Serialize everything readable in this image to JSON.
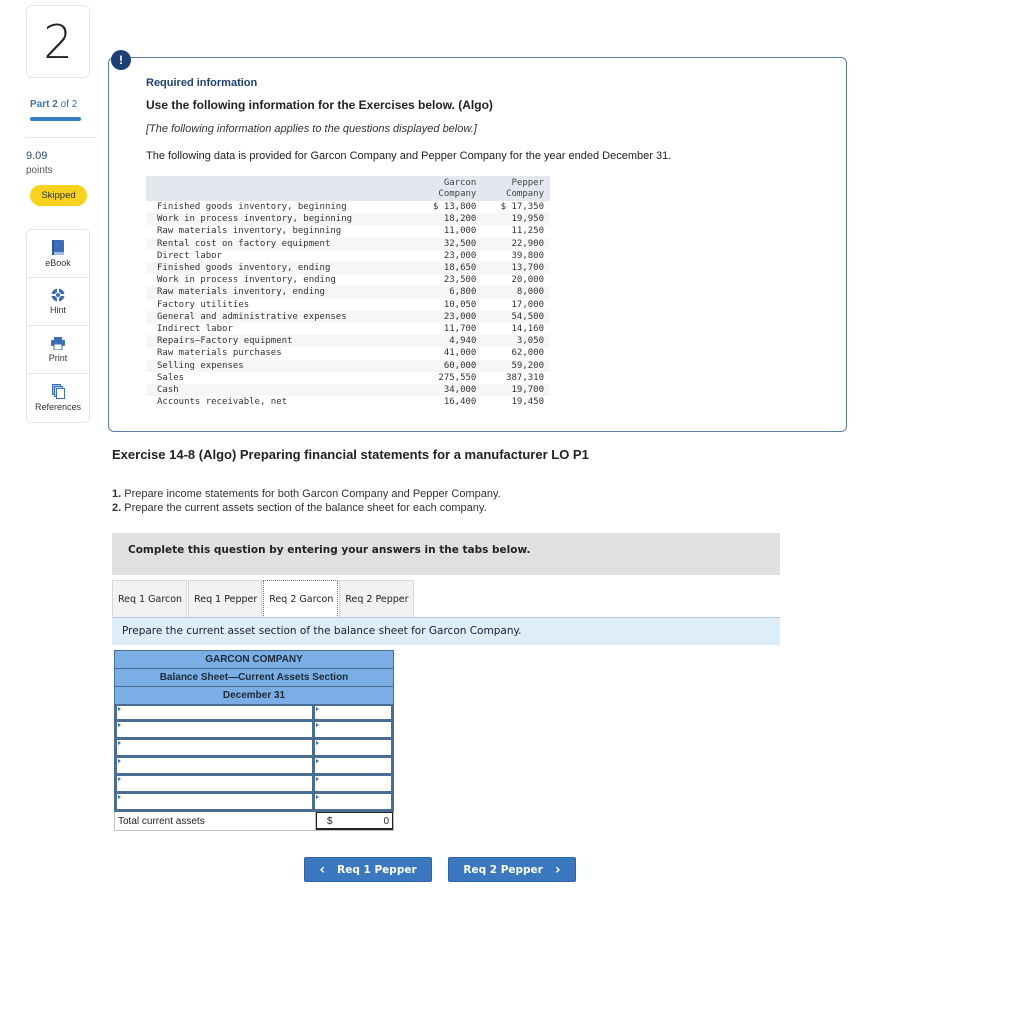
{
  "question": {
    "number": "2",
    "part_label": "Part",
    "part_current": "2",
    "part_of": "of 2",
    "part_progress": 1.0,
    "points_value": "9.09",
    "points_label": "points",
    "status": "Skipped"
  },
  "tools": [
    {
      "label": "eBook",
      "icon": "book-icon"
    },
    {
      "label": "Hint",
      "icon": "lifebuoy-icon"
    },
    {
      "label": "Print",
      "icon": "printer-icon"
    },
    {
      "label": "References",
      "icon": "documents-icon"
    }
  ],
  "info_card": {
    "badge": "!",
    "heading": "Required information",
    "title": "Use the following information for the Exercises below. (Algo)",
    "applies_note": "[The following information applies to the questions displayed below.]",
    "intro": "The following data is provided for Garcon Company and Pepper Company for the year ended December 31.",
    "table": {
      "headers": [
        "",
        "Garcon\nCompany",
        "Pepper\nCompany"
      ],
      "header_lines": [
        [
          "Garcon",
          "Company"
        ],
        [
          "Pepper",
          "Company"
        ]
      ],
      "rows": [
        {
          "label": "Finished goods inventory, beginning",
          "garcon": "$ 13,800",
          "pepper": "$ 17,350"
        },
        {
          "label": "Work in process inventory, beginning",
          "garcon": "18,200",
          "pepper": "19,950"
        },
        {
          "label": "Raw materials inventory, beginning",
          "garcon": "11,000",
          "pepper": "11,250"
        },
        {
          "label": "Rental cost on factory equipment",
          "garcon": "32,500",
          "pepper": "22,900"
        },
        {
          "label": "Direct labor",
          "garcon": "23,000",
          "pepper": "39,800"
        },
        {
          "label": "Finished goods inventory, ending",
          "garcon": "18,650",
          "pepper": "13,700"
        },
        {
          "label": "Work in process inventory, ending",
          "garcon": "23,500",
          "pepper": "20,000"
        },
        {
          "label": "Raw materials inventory, ending",
          "garcon": "6,800",
          "pepper": "8,000"
        },
        {
          "label": "Factory utilities",
          "garcon": "10,050",
          "pepper": "17,000"
        },
        {
          "label": "General and administrative expenses",
          "garcon": "23,000",
          "pepper": "54,500"
        },
        {
          "label": "Indirect labor",
          "garcon": "11,700",
          "pepper": "14,160"
        },
        {
          "label": "Repairs—Factory equipment",
          "garcon": "4,940",
          "pepper": "3,050"
        },
        {
          "label": "Raw materials purchases",
          "garcon": "41,000",
          "pepper": "62,000"
        },
        {
          "label": "Selling expenses",
          "garcon": "60,000",
          "pepper": "59,200"
        },
        {
          "label": "Sales",
          "garcon": "275,550",
          "pepper": "387,310"
        },
        {
          "label": "Cash",
          "garcon": "34,000",
          "pepper": "19,700"
        },
        {
          "label": "Accounts receivable, net",
          "garcon": "16,400",
          "pepper": "19,450"
        }
      ]
    }
  },
  "exercise": {
    "title": "Exercise 14-8 (Algo) Preparing financial statements for a manufacturer LO P1",
    "items": [
      {
        "num": "1.",
        "text": "Prepare income statements for both Garcon Company and Pepper Company."
      },
      {
        "num": "2.",
        "text": "Prepare the current assets section of the balance sheet for each company."
      }
    ],
    "complete_instruction": "Complete this question by entering your answers in the tabs below.",
    "tabs": [
      {
        "label": "Req 1 Garcon",
        "active": false
      },
      {
        "label": "Req 1 Pepper",
        "active": false
      },
      {
        "label": "Req 2 Garcon",
        "active": true
      },
      {
        "label": "Req 2 Pepper",
        "active": false
      }
    ],
    "tab_instruction": "Prepare the current asset section of the balance sheet for Garcon Company."
  },
  "balance_sheet": {
    "company": "GARCON COMPANY",
    "title": "Balance Sheet—Current Assets Section",
    "date": "December 31",
    "rows": [
      {
        "label": "",
        "amount": ""
      },
      {
        "label": "",
        "amount": ""
      },
      {
        "label": "",
        "amount": ""
      },
      {
        "label": "",
        "amount": ""
      },
      {
        "label": "",
        "amount": ""
      },
      {
        "label": "",
        "amount": ""
      }
    ],
    "total_label": "Total current assets",
    "total_currency": "$",
    "total_value": "0"
  },
  "navigation": {
    "prev_label": "Req 1 Pepper",
    "prev_arrow": "‹",
    "next_label": "Req 2 Pepper",
    "next_arrow": "›"
  },
  "colors": {
    "accent_blue": "#3b78bf",
    "badge_navy": "#1e3f73",
    "skipped_yellow": "#f8d21c",
    "table_header_blue": "#7aaee4",
    "instruction_bar": "#ddeefa"
  }
}
